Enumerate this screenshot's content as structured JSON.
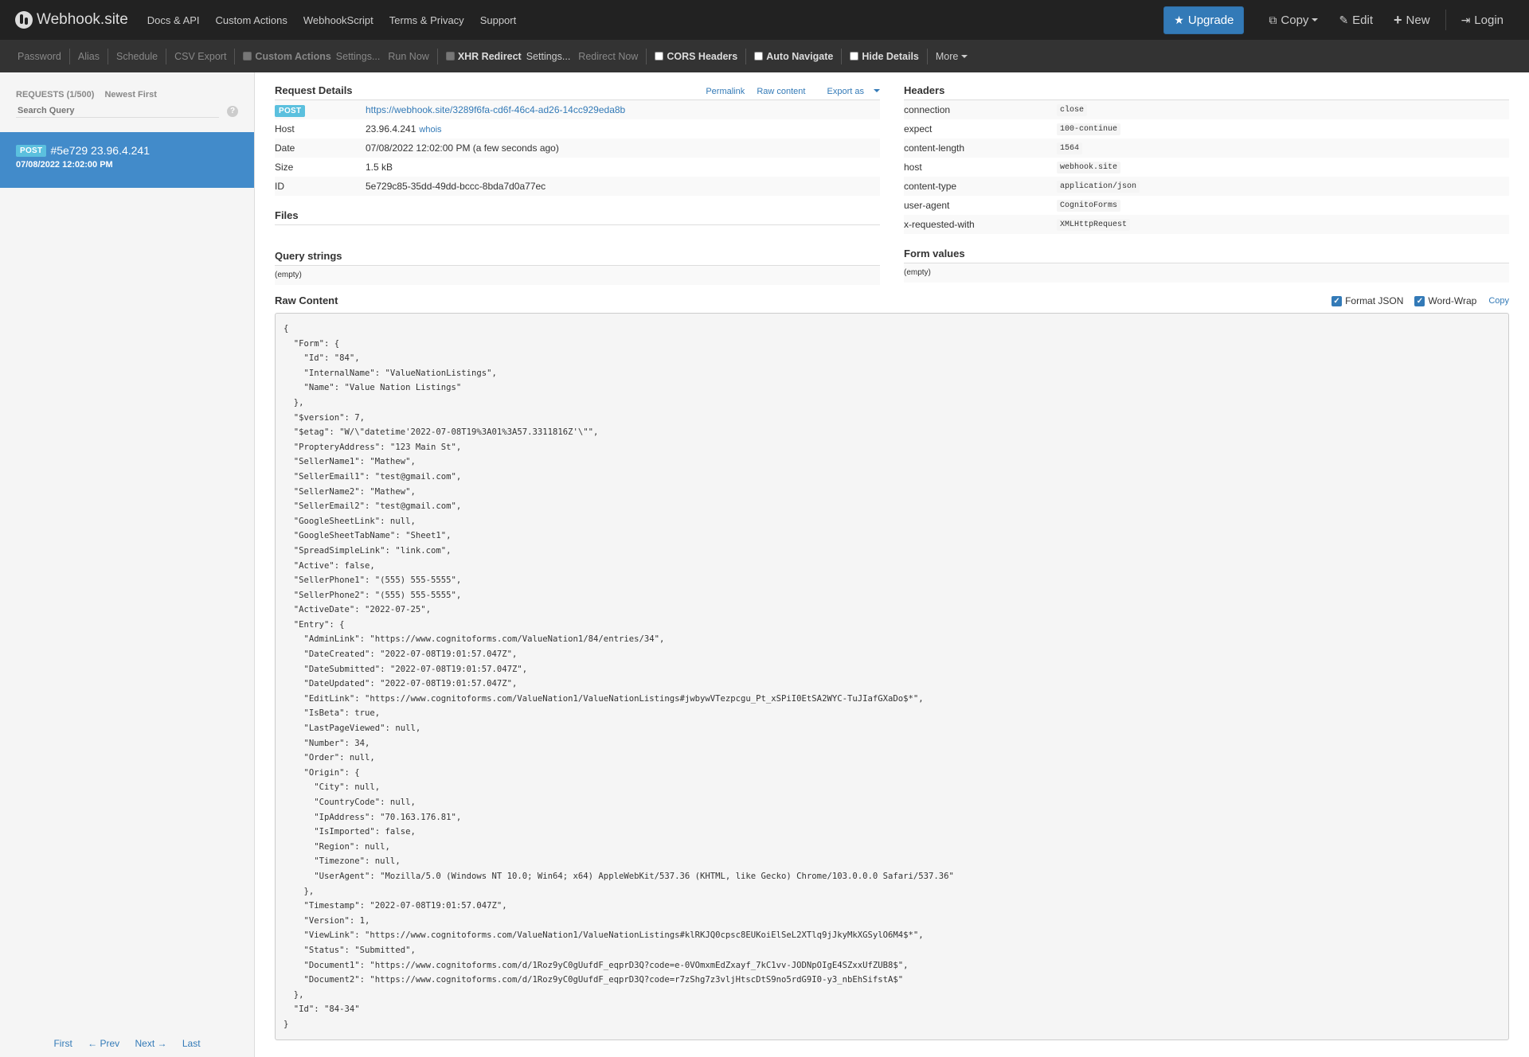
{
  "navbar": {
    "brand": "Webhook.site",
    "links": [
      "Docs & API",
      "Custom Actions",
      "WebhookScript",
      "Terms & Privacy",
      "Support"
    ],
    "upgrade": "Upgrade",
    "copy": "Copy",
    "edit": "Edit",
    "new": "New",
    "login": "Login"
  },
  "toolbar": {
    "password": "Password",
    "alias": "Alias",
    "schedule": "Schedule",
    "csv_export": "CSV Export",
    "custom_actions": "Custom Actions",
    "settings": "Settings...",
    "run_now": "Run Now",
    "xhr_redirect": "XHR Redirect",
    "xhr_settings": "Settings...",
    "redirect_now": "Redirect Now",
    "cors_headers": "CORS Headers",
    "auto_navigate": "Auto Navigate",
    "hide_details": "Hide Details",
    "more": "More"
  },
  "sidebar": {
    "requests_label": "REQUESTS (1/500)",
    "sort_label": "Newest First",
    "search_placeholder": "Search Query",
    "help": "?",
    "items": [
      {
        "method": "POST",
        "title": "#5e729 23.96.4.241",
        "time": "07/08/2022 12:02:00 PM"
      }
    ],
    "pager": {
      "first": "First",
      "prev": "← Prev",
      "next": "Next →",
      "last": "Last"
    }
  },
  "details": {
    "title": "Request Details",
    "permalink": "Permalink",
    "raw_content": "Raw content",
    "export_as": "Export as",
    "method": "POST",
    "url": "https://webhook.site/3289f6fa-cd6f-46c4-ad26-14cc929eda8b",
    "host_label": "Host",
    "host": "23.96.4.241",
    "whois": "whois",
    "date_label": "Date",
    "date": "07/08/2022 12:02:00 PM (a few seconds ago)",
    "size_label": "Size",
    "size": "1.5 kB",
    "id_label": "ID",
    "id": "5e729c85-35dd-49dd-bccc-8bda7d0a77ec"
  },
  "headers": {
    "title": "Headers",
    "rows": [
      {
        "key": "connection",
        "value": "close"
      },
      {
        "key": "expect",
        "value": "100-continue"
      },
      {
        "key": "content-length",
        "value": "1564"
      },
      {
        "key": "host",
        "value": "webhook.site"
      },
      {
        "key": "content-type",
        "value": "application/json"
      },
      {
        "key": "user-agent",
        "value": "CognitoForms"
      },
      {
        "key": "x-requested-with",
        "value": "XMLHttpRequest"
      }
    ]
  },
  "files": {
    "title": "Files"
  },
  "query": {
    "title": "Query strings",
    "value": "(empty)"
  },
  "form": {
    "title": "Form values",
    "value": "(empty)"
  },
  "raw": {
    "title": "Raw Content",
    "format_json": "Format JSON",
    "word_wrap": "Word-Wrap",
    "copy": "Copy",
    "body": "{\n  \"Form\": {\n    \"Id\": \"84\",\n    \"InternalName\": \"ValueNationListings\",\n    \"Name\": \"Value Nation Listings\"\n  },\n  \"$version\": 7,\n  \"$etag\": \"W/\\\"datetime'2022-07-08T19%3A01%3A57.3311816Z'\\\"\",\n  \"PropteryAddress\": \"123 Main St\",\n  \"SellerName1\": \"Mathew\",\n  \"SellerEmail1\": \"test@gmail.com\",\n  \"SellerName2\": \"Mathew\",\n  \"SellerEmail2\": \"test@gmail.com\",\n  \"GoogleSheetLink\": null,\n  \"GoogleSheetTabName\": \"Sheet1\",\n  \"SpreadSimpleLink\": \"link.com\",\n  \"Active\": false,\n  \"SellerPhone1\": \"(555) 555-5555\",\n  \"SellerPhone2\": \"(555) 555-5555\",\n  \"ActiveDate\": \"2022-07-25\",\n  \"Entry\": {\n    \"AdminLink\": \"https://www.cognitoforms.com/ValueNation1/84/entries/34\",\n    \"DateCreated\": \"2022-07-08T19:01:57.047Z\",\n    \"DateSubmitted\": \"2022-07-08T19:01:57.047Z\",\n    \"DateUpdated\": \"2022-07-08T19:01:57.047Z\",\n    \"EditLink\": \"https://www.cognitoforms.com/ValueNation1/ValueNationListings#jwbywVTezpcgu_Pt_xSPiI0EtSA2WYC-TuJIafGXaDo$*\",\n    \"IsBeta\": true,\n    \"LastPageViewed\": null,\n    \"Number\": 34,\n    \"Order\": null,\n    \"Origin\": {\n      \"City\": null,\n      \"CountryCode\": null,\n      \"IpAddress\": \"70.163.176.81\",\n      \"IsImported\": false,\n      \"Region\": null,\n      \"Timezone\": null,\n      \"UserAgent\": \"Mozilla/5.0 (Windows NT 10.0; Win64; x64) AppleWebKit/537.36 (KHTML, like Gecko) Chrome/103.0.0.0 Safari/537.36\"\n    },\n    \"Timestamp\": \"2022-07-08T19:01:57.047Z\",\n    \"Version\": 1,\n    \"ViewLink\": \"https://www.cognitoforms.com/ValueNation1/ValueNationListings#klRKJQ0cpsc8EUKoiElSeL2XTlq9jJkyMkXGSylO6M4$*\",\n    \"Status\": \"Submitted\",\n    \"Document1\": \"https://www.cognitoforms.com/d/1Roz9yC0gUufdF_eqprD3Q?code=e-0VOmxmEdZxayf_7kC1vv-JODNpOIgE4SZxxUfZUB8$\",\n    \"Document2\": \"https://www.cognitoforms.com/d/1Roz9yC0gUufdF_eqprD3Q?code=r7zShg7z3vljHtscDtS9no5rdG9I0-y3_nbEhSifstA$\"\n  },\n  \"Id\": \"84-34\"\n}"
  }
}
